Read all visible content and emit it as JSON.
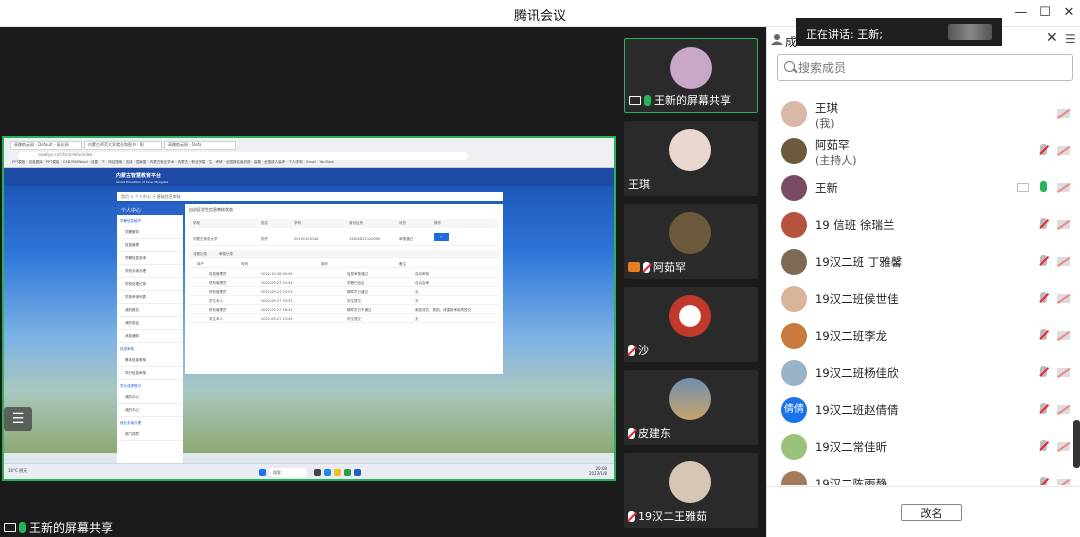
{
  "window": {
    "title": "腾讯会议",
    "controls": [
      "minimize",
      "maximize",
      "close"
    ]
  },
  "speaking_banner": {
    "text": "正在讲话: 王新;"
  },
  "stage": {
    "shared_label": "王新的屏幕共享",
    "browser": {
      "tabs": [
        "高棚航云网 - Default - 高长网",
        "内蒙古师范大学就业和图书 · 职",
        "高棚航云网 - Defa"
      ],
      "address": "newbys.cn/cfsn/cfefu/index",
      "bookmarks": [
        "PPT模板",
        "百度图库",
        "PPT模板",
        "CAD/RIMWood",
        "设置 · 下",
        "网站搜索",
        "连接",
        "国家图",
        "内蒙古就业学术",
        "内蒙古 · 职业学星",
        "生",
        "考研 · 全国报名组织部",
        "高棚 · 全国成人高考",
        "个人学明",
        "Gmail",
        "YouTube"
      ],
      "site_logo": "内蒙古智慧教育平台",
      "site_logo_en": "Smart Education of Inner Mongolia",
      "breadcrumb": "首页 > 个人中心 > 基础信息审核",
      "left_menu_head": "个人中心",
      "left_menu_sections": [
        {
          "title": "学籍信息维护",
          "items": [
            "学籍服务",
            "信息管理",
            "学籍信息查询",
            "学校手续办理",
            "学校处理记录",
            "学校申请列表",
            "我的报名",
            "我的验证",
            "消息通知"
          ]
        },
        {
          "title": "信息审核",
          "items": [
            "基本信息审核",
            "学分信息审核"
          ]
        },
        {
          "title": "学业成绩登记",
          "items": [
            "我的中心",
            "我的中心"
          ]
        },
        {
          "title": "就业手续办理",
          "items": [
            "部门领导"
          ]
        }
      ],
      "panel_title": "自治区学生信息审核状态",
      "info_headers": [
        "学校",
        "姓名",
        "学号",
        "身份证号",
        "状态",
        "操作"
      ],
      "info_row": [
        "内蒙古师范大学",
        "张柠",
        "20192105146",
        "15632821120090",
        "审核通过",
        "✓"
      ],
      "log_tabs": [
        "流程记录",
        "审核记录"
      ],
      "log_headers": [
        "用户",
        "时间",
        "操作",
        "备注"
      ],
      "log_rows": [
        [
          "信息管理员",
          "2022-10-08 09:05",
          "信息审核通过",
          "自动审核"
        ],
        [
          "院系管理员",
          "2022-09-27 23:54",
          "学籍已验证",
          "自治会审"
        ],
        [
          "院系管理员",
          "2022-09-27 23:53",
          "辅导员已通过",
          "无"
        ],
        [
          "学生本人",
          "2022-09-27 23:52",
          "学生提交",
          "无"
        ],
        [
          "院系管理员",
          "2022-09-27 18:41",
          "辅导员已不通过",
          "家庭成员、原因、请重新审阅再提交"
        ],
        [
          "学生本人",
          "2022-09-27 13:45",
          "学生提交",
          "无"
        ]
      ],
      "taskbar": {
        "weather": "10°C 阴天",
        "search": "搜索",
        "time": "20:08",
        "date": "2023/1/8"
      }
    }
  },
  "video_tiles": [
    {
      "name": "王新的屏幕共享",
      "mic": "on",
      "screen": true,
      "active": true,
      "avatar_color": "#c9a7c7"
    },
    {
      "name": "王琪",
      "mic": "none",
      "screen": false,
      "active": false,
      "avatar_color": "#e8d8cf"
    },
    {
      "name": "阿茹罕",
      "mic": "off",
      "screen": false,
      "active": false,
      "cam": true,
      "avatar_color": "#6b5a3c"
    },
    {
      "name": "沙",
      "mic": "off",
      "screen": false,
      "active": false,
      "avatar_color": "#c0392b"
    },
    {
      "name": "皮建东",
      "mic": "off",
      "screen": false,
      "active": false,
      "avatar_color": "#6f8fb0"
    },
    {
      "name": "19汉二王雅茹",
      "mic": "off",
      "screen": false,
      "active": false,
      "avatar_color": "#d6c7b4"
    }
  ],
  "members_panel": {
    "header_label": "成",
    "search_placeholder": "搜索成员",
    "rename_label": "改名",
    "members": [
      {
        "name": "王琪",
        "sub": "(我)",
        "mic": "off",
        "cam": "off",
        "avatar_color": "#d9b8a8"
      },
      {
        "name": "阿茹罕",
        "sub": "(主持人)",
        "mic": "off",
        "cam": "off",
        "avatar_color": "#6b5a3c"
      },
      {
        "name": "王新",
        "sub": "",
        "mic": "on",
        "cam": "off",
        "screen": true,
        "avatar_color": "#7a4c63"
      },
      {
        "name": "19 信班 徐瑞兰",
        "sub": "",
        "mic": "off",
        "cam": "off",
        "avatar_color": "#b5533c"
      },
      {
        "name": "19汉二班 丁雅馨",
        "sub": "",
        "mic": "off",
        "cam": "off",
        "avatar_color": "#7d6a54"
      },
      {
        "name": "19汉二班侯世佳",
        "sub": "",
        "mic": "off",
        "cam": "off",
        "avatar_color": "#d8b49a"
      },
      {
        "name": "19汉二班李龙",
        "sub": "",
        "mic": "off",
        "cam": "off",
        "avatar_color": "#c97b3e"
      },
      {
        "name": "19汉二班杨佳欣",
        "sub": "",
        "mic": "off",
        "cam": "off",
        "avatar_color": "#9ab3c9"
      },
      {
        "name": "19汉二班赵倩倩",
        "sub": "",
        "mic": "off",
        "cam": "off",
        "avatar_color": "#1a73e8",
        "avatar_text": "倩倩"
      },
      {
        "name": "19汉二常佳昕",
        "sub": "",
        "mic": "off",
        "cam": "off",
        "avatar_color": "#9bc27a"
      },
      {
        "name": "19汉二陈雨静",
        "sub": "",
        "mic": "off",
        "cam": "off",
        "avatar_color": "#a37a5c"
      }
    ]
  }
}
